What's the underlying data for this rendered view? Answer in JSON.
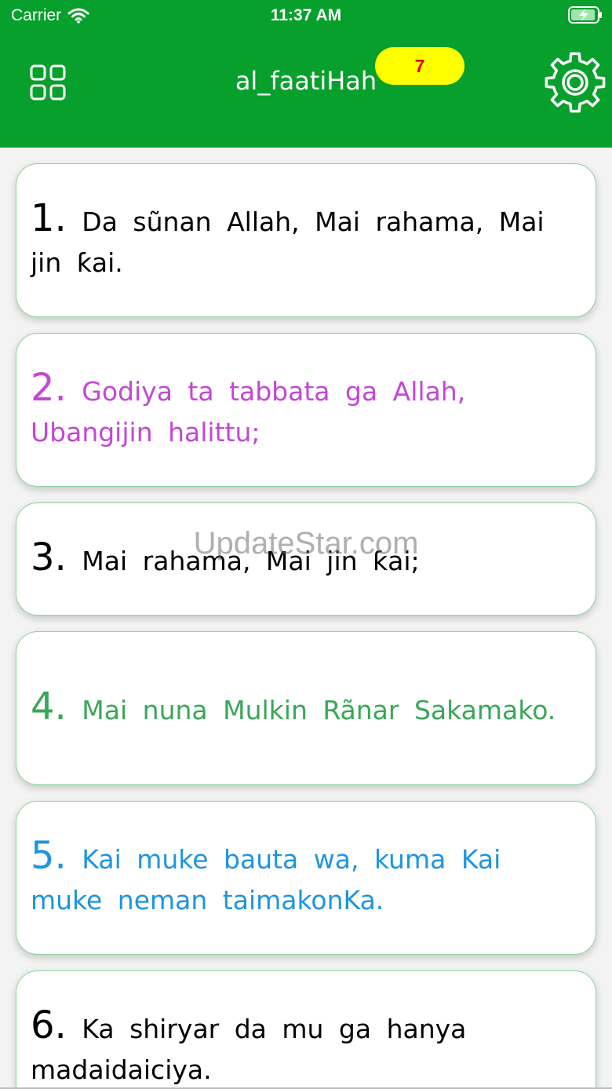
{
  "status_bar": {
    "carrier": "Carrier",
    "time": "11:37 AM",
    "icons": [
      "wifi-icon",
      "battery-charging-icon"
    ]
  },
  "nav": {
    "title": "al_faatiHah",
    "badge": "7",
    "left_icon": "grid-icon",
    "right_icon": "gear-icon",
    "bar_color": "#07a02c",
    "badge_color": "#ffff00"
  },
  "verses": [
    {
      "num": "1.",
      "text": "Da sũnan Allah, Mai rahama, Mai jin ƙai.",
      "color": "#000000"
    },
    {
      "num": "2.",
      "text": "Godiya ta tabbata ga Allah, Ubangijin halittu;",
      "color": "#c347d4"
    },
    {
      "num": "3.",
      "text": "Mai rahama, Mai jin ƙai;",
      "color": "#000000"
    },
    {
      "num": "4.",
      "text": "Mai nuna Mulkin Rãnar Sakamako.",
      "color": "#3aa658"
    },
    {
      "num": "5.",
      "text": "Kai muke bauta wa, kuma Kai muke neman taimakonKa.",
      "color": "#1e95e0"
    },
    {
      "num": "6.",
      "text": "Ka shiryar da mu ga hanya madaidaiciya.",
      "color": "#000000"
    }
  ],
  "watermark": "UpdateStar.com"
}
